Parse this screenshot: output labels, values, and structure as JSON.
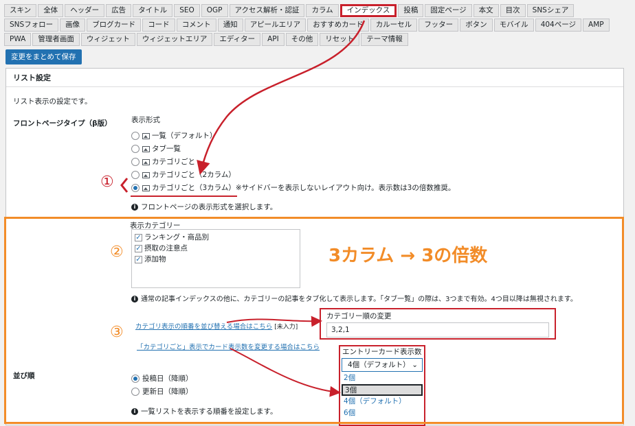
{
  "tabs": [
    "スキン",
    "全体",
    "ヘッダー",
    "広告",
    "タイトル",
    "SEO",
    "OGP",
    "アクセス解析・認証",
    "カラム",
    "インデックス",
    "投稿",
    "固定ページ",
    "本文",
    "目次",
    "SNSシェア",
    "SNSフォロー",
    "画像",
    "ブログカード",
    "コード",
    "コメント",
    "通知",
    "アピールエリア",
    "おすすめカード",
    "カルーセル",
    "フッター",
    "ボタン",
    "モバイル",
    "404ページ",
    "AMP",
    "PWA",
    "管理者画面",
    "ウィジェット",
    "ウィジェットエリア",
    "エディター",
    "API",
    "その他",
    "リセット",
    "テーマ情報"
  ],
  "active_tab": "インデックス",
  "save_button": "変更をまとめて保存",
  "panel_title": "リスト設定",
  "panel_desc": "リスト表示の設定です。",
  "front_label": "フロントページタイプ（β版）",
  "display_format_label": "表示形式",
  "format_options": [
    "一覧（デフォルト）",
    "タブ一覧",
    "カテゴリごと",
    "カテゴリごと（2カラム）",
    "カテゴリごと（3カラム）"
  ],
  "format_note": "※サイドバーを表示しないレイアウト向け。表示数は3の倍数推奨。",
  "format_help": "フロントページの表示形式を選択します。",
  "display_category_label": "表示カテゴリー",
  "categories": [
    "ランキング・商品別",
    "摂取の注意点",
    "添加物"
  ],
  "category_help": "通常の記事インデックスの他に、カテゴリーの記事をタブ化して表示します。「タブ一覧」の際は、3つまで有効。4つ目以降は無視されます。",
  "link_reorder": "カテゴリ表示の順番を並び替える場合はこちら",
  "link_reorder_note": "[未入力]",
  "link_cardcount": "「カテゴリごと」表示でカード表示数を変更する場合はこちら",
  "order_change_label": "カテゴリー順の変更",
  "order_change_value": "3,2,1",
  "entry_count_label": "エントリーカード表示数",
  "entry_count_selected": "4個（デフォルト）",
  "entry_count_options": [
    "2個",
    "3個",
    "4個（デフォルト）",
    "6個"
  ],
  "sort_label": "並び順",
  "sort_options": [
    "投稿日（降順）",
    "更新日（降順）"
  ],
  "sort_help": "一覧リストを表示する順番を設定します。",
  "annotation_big": "3カラム → 3の倍数",
  "num1": "①",
  "num2": "②",
  "num3": "③",
  "colors": {
    "accent": "#2271b1",
    "red": "#c8202b",
    "orange": "#f28c28"
  }
}
